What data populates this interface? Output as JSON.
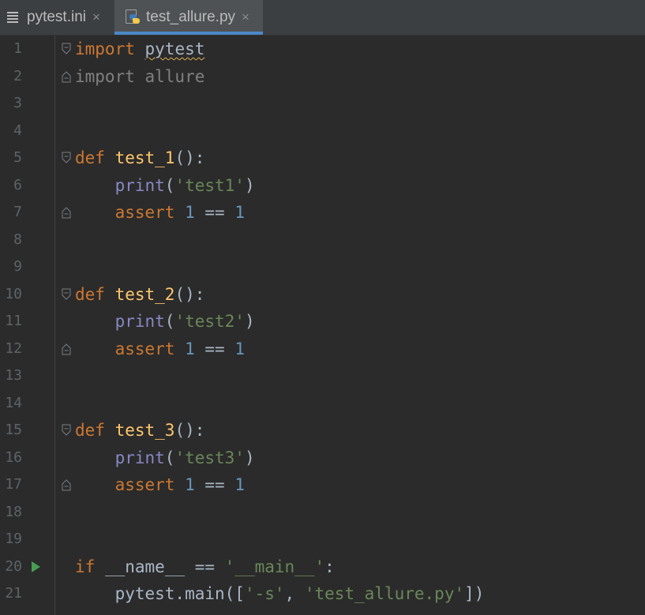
{
  "tabs": [
    {
      "label": "pytest.ini",
      "icon": "ini-file-icon",
      "active": false
    },
    {
      "label": "test_allure.py",
      "icon": "python-file-icon",
      "active": true
    }
  ],
  "close_glyph": "×",
  "lines": {
    "l1": {
      "n": "1",
      "a": "import",
      "b": " ",
      "c": "pytest"
    },
    "l2": {
      "n": "2",
      "a": "import",
      "b": " allure"
    },
    "l3": {
      "n": "3"
    },
    "l4": {
      "n": "4"
    },
    "l5": {
      "n": "5",
      "a": "def",
      "b": " ",
      "c": "test_1",
      "d": "():"
    },
    "l6": {
      "n": "6",
      "a": "    ",
      "b": "print",
      "c": "(",
      "d": "'test1'",
      "e": ")"
    },
    "l7": {
      "n": "7",
      "a": "    ",
      "b": "assert",
      "c": " ",
      "d": "1",
      "e": " == ",
      "f": "1"
    },
    "l8": {
      "n": "8"
    },
    "l9": {
      "n": "9"
    },
    "l10": {
      "n": "10",
      "a": "def",
      "b": " ",
      "c": "test_2",
      "d": "():"
    },
    "l11": {
      "n": "11",
      "a": "    ",
      "b": "print",
      "c": "(",
      "d": "'test2'",
      "e": ")"
    },
    "l12": {
      "n": "12",
      "a": "    ",
      "b": "assert",
      "c": " ",
      "d": "1",
      "e": " == ",
      "f": "1"
    },
    "l13": {
      "n": "13"
    },
    "l14": {
      "n": "14"
    },
    "l15": {
      "n": "15",
      "a": "def",
      "b": " ",
      "c": "test_3",
      "d": "():"
    },
    "l16": {
      "n": "16",
      "a": "    ",
      "b": "print",
      "c": "(",
      "d": "'test3'",
      "e": ")"
    },
    "l17": {
      "n": "17",
      "a": "    ",
      "b": "assert",
      "c": " ",
      "d": "1",
      "e": " == ",
      "f": "1"
    },
    "l18": {
      "n": "18"
    },
    "l19": {
      "n": "19"
    },
    "l20": {
      "n": "20",
      "a": "if",
      "b": " __name__ == ",
      "c": "'__main__'",
      "d": ":"
    },
    "l21": {
      "n": "21",
      "a": "    pytest.main([",
      "b": "'-s'",
      "c": ", ",
      "d": "'test_allure.py'",
      "e": "])"
    }
  },
  "colors": {
    "keyword": "#cc7832",
    "function": "#ffc66d",
    "builtin": "#8888c6",
    "string": "#6a8759",
    "number": "#6897bb",
    "text": "#a9b7c6",
    "active_tab_underline": "#4a88c7",
    "run_icon": "#499c54"
  }
}
